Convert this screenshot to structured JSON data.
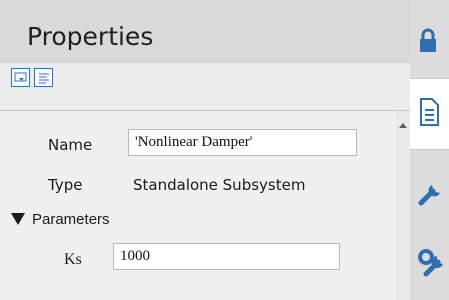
{
  "panel": {
    "title": "Properties",
    "toolbar": {
      "buttons": [
        {
          "icon": "dropdown-view-icon"
        },
        {
          "icon": "list-view-icon"
        }
      ]
    },
    "fields": {
      "name_label": "Name",
      "name_value": "'Nonlinear Damper'",
      "type_label": "Type",
      "type_value": "Standalone Subsystem",
      "parameters_label": "Parameters",
      "ks_label": "Ks",
      "ks_value": "1000"
    }
  },
  "side_tabs": [
    {
      "icon": "lock-icon"
    },
    {
      "icon": "document-icon",
      "active": true
    },
    {
      "icon": "wrench-icon"
    },
    {
      "icon": "gear-wrench-icon"
    }
  ],
  "colors": {
    "accent": "#2a6fd6",
    "title_bar": "#d9d9d9",
    "panel_bg": "#ececec",
    "icon_blue": "#2f6fb0"
  }
}
